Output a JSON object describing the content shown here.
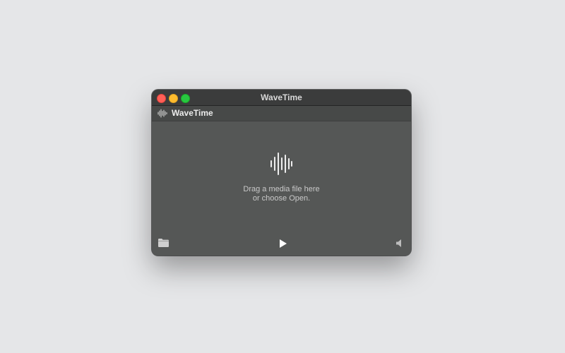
{
  "window": {
    "title": "WaveTime"
  },
  "toolbar": {
    "app_name": "WaveTime",
    "icon": "waveform-icon"
  },
  "drop_zone": {
    "icon": "waveform-icon",
    "line1": "Drag a media file here",
    "line2": "or choose Open."
  },
  "controls": {
    "open_icon": "folder-icon",
    "play_icon": "play-icon",
    "volume_icon": "speaker-icon"
  },
  "colors": {
    "window_bg": "#555756",
    "titlebar_bg": "#3b3c3c",
    "close": "#ff5f57",
    "minimize": "#febc2e",
    "maximize": "#28c840"
  }
}
